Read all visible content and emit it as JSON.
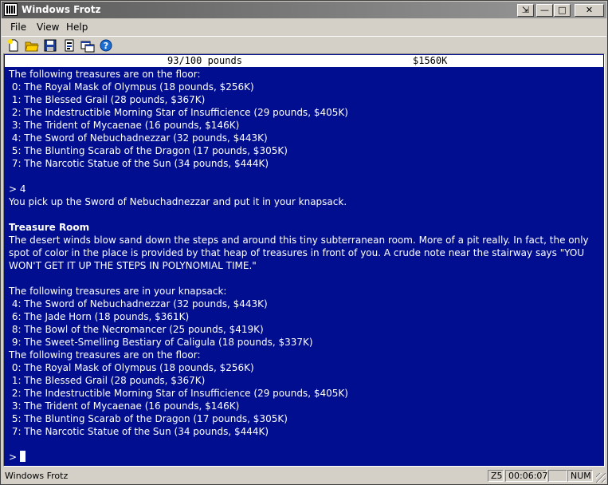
{
  "window": {
    "title": "Windows Frotz"
  },
  "title_buttons": {
    "restore_label": "⇲",
    "minimize_label": "—",
    "maximize_label": "□",
    "close_label": "✕"
  },
  "menu": {
    "file": "File",
    "view": "View",
    "help": "Help"
  },
  "toolbar": {
    "icons": [
      "new-icon",
      "open-icon",
      "save-icon",
      "options-icon",
      "window-icon",
      "help-icon"
    ]
  },
  "status": {
    "weight": "93/100 pounds",
    "money": "$1560K"
  },
  "transcript": {
    "floor_header_1": "The following treasures are on the floor:",
    "floor_items_1": [
      " 0: The Royal Mask of Olympus (18 pounds, $256K)",
      " 1: The Blessed Grail (28 pounds, $367K)",
      " 2: The Indestructible Morning Star of Insufficience (29 pounds, $405K)",
      " 3: The Trident of Mycaenae (16 pounds, $146K)",
      " 4: The Sword of Nebuchadnezzar (32 pounds, $443K)",
      " 5: The Blunting Scarab of the Dragon (17 pounds, $305K)",
      " 7: The Narcotic Statue of the Sun (34 pounds, $444K)"
    ],
    "command": "> 4",
    "response": "You pick up the Sword of Nebuchadnezzar and put it in your knapsack.",
    "room_name": "Treasure Room",
    "room_desc": "The desert winds blow sand down the steps and around this tiny subterranean room. More of a pit really. In fact, the only spot of color in the place is provided by that heap of treasures in front of you. A crude note near the stairway says \"YOU WON'T GET IT UP THE STEPS IN POLYNOMIAL TIME.\"",
    "knapsack_header": "The following treasures are in your knapsack:",
    "knapsack_items": [
      " 4: The Sword of Nebuchadnezzar (32 pounds, $443K)",
      " 6: The Jade Horn (18 pounds, $361K)",
      " 8: The Bowl of the Necromancer (25 pounds, $419K)",
      " 9: The Sweet-Smelling Bestiary of Caligula (18 pounds, $337K)"
    ],
    "floor_header_2": "The following treasures are on the floor:",
    "floor_items_2": [
      " 0: The Royal Mask of Olympus (18 pounds, $256K)",
      " 1: The Blessed Grail (28 pounds, $367K)",
      " 2: The Indestructible Morning Star of Insufficience (29 pounds, $405K)",
      " 3: The Trident of Mycaenae (16 pounds, $146K)",
      " 5: The Blunting Scarab of the Dragon (17 pounds, $305K)",
      " 7: The Narcotic Statue of the Sun (34 pounds, $444K)"
    ],
    "prompt": "> "
  },
  "statusbar": {
    "app": "Windows Frotz",
    "version": "Z5",
    "time": "00:06:07",
    "num": "NUM"
  },
  "colors": {
    "background": "#000e8f",
    "text": "#ffffff"
  }
}
